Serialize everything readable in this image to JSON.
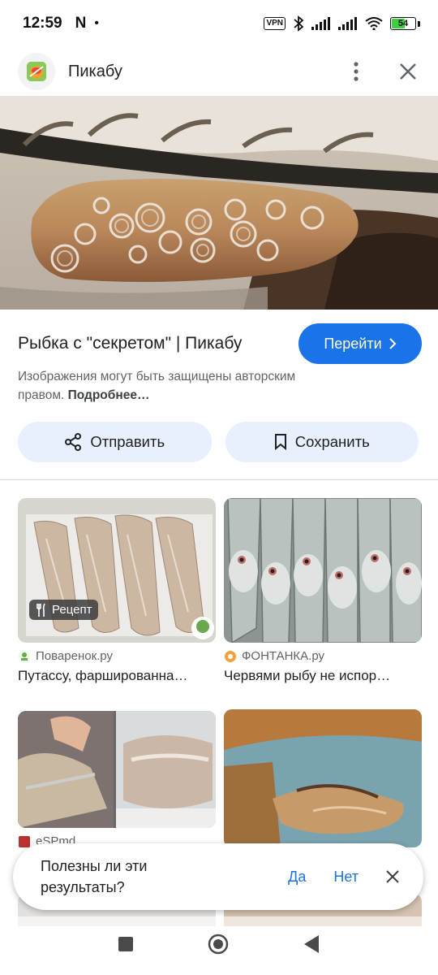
{
  "status": {
    "time": "12:59",
    "notification_letter": "N",
    "dot": "•",
    "vpn_label": "VPN",
    "battery": "54"
  },
  "header": {
    "site_name": "Пикабу"
  },
  "result": {
    "title": "Рыбка с \"секретом\" | Пикабу",
    "visit_label": "Перейти",
    "copyright_text": "Изображения могут быть защищены авторским правом.",
    "copyright_more": "Подробнее…",
    "share_label": "Отправить",
    "save_label": "Сохранить"
  },
  "related": [
    {
      "source": "Поваренок.ру",
      "caption": "Путассу, фаршированна…",
      "badge": "Рецепт"
    },
    {
      "source": "ФОНТАНКА.ру",
      "caption": "Червями рыбу не испор…"
    },
    {
      "source": "eSPmd"
    }
  ],
  "feedback": {
    "question": "Полезны ли эти результаты?",
    "yes": "Да",
    "no": "Нет"
  },
  "colors": {
    "accent": "#1a73e8",
    "pill_bg": "#e8f0fe"
  }
}
